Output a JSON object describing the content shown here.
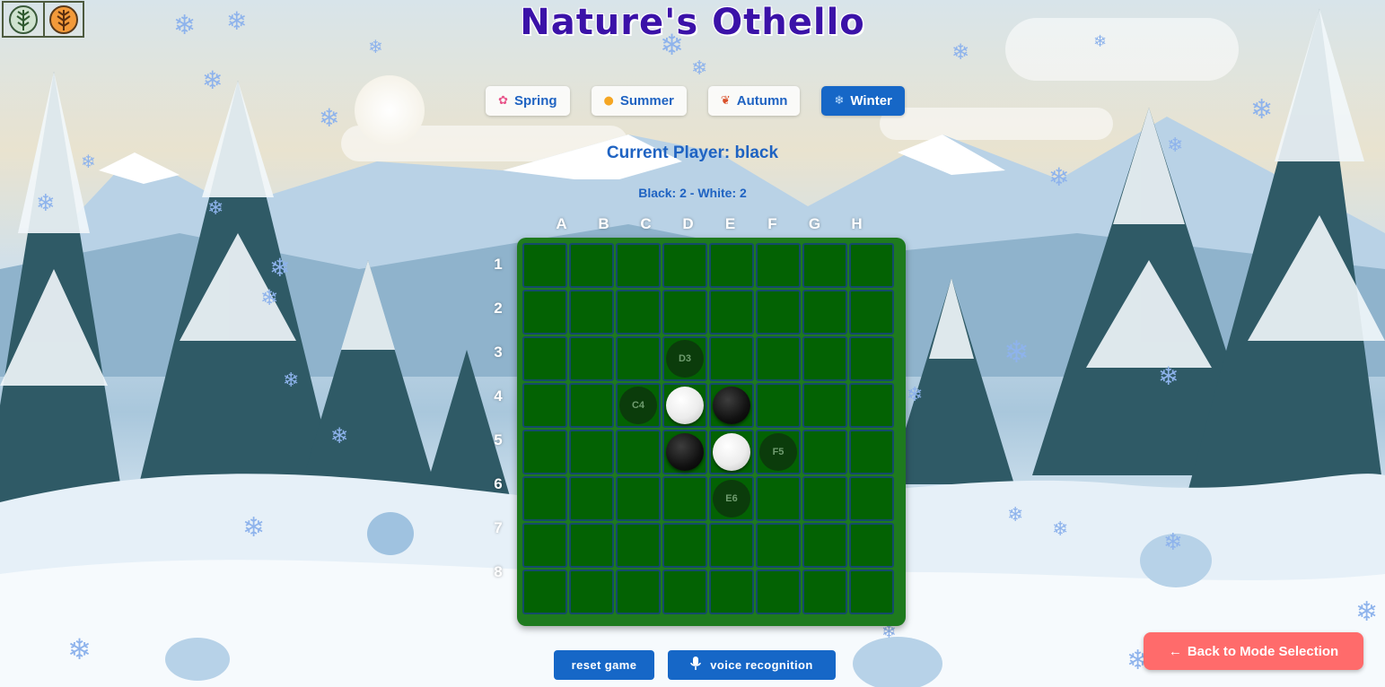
{
  "title": "Nature's Othello",
  "colors": {
    "title": "#3b12a8",
    "accent_blue": "#1667c7",
    "board": "#036203",
    "back_button": "#ff6b6b"
  },
  "seasons": [
    {
      "label": "Spring",
      "icon": "flower-icon",
      "active": false
    },
    {
      "label": "Summer",
      "icon": "sun-icon",
      "active": false
    },
    {
      "label": "Autumn",
      "icon": "leaf-icon",
      "active": false
    },
    {
      "label": "Winter",
      "icon": "snowflake-icon",
      "active": true
    }
  ],
  "status": {
    "current_player": "Current Player: black",
    "score": "Black: 2 - White: 2"
  },
  "board": {
    "columns": [
      "A",
      "B",
      "C",
      "D",
      "E",
      "F",
      "G",
      "H"
    ],
    "rows": [
      "1",
      "2",
      "3",
      "4",
      "5",
      "6",
      "7",
      "8"
    ],
    "pieces": [
      {
        "cell": "D4",
        "color": "white"
      },
      {
        "cell": "E4",
        "color": "black"
      },
      {
        "cell": "D5",
        "color": "black"
      },
      {
        "cell": "E5",
        "color": "white"
      }
    ],
    "valid_moves": [
      "D3",
      "C4",
      "F5",
      "E6"
    ]
  },
  "controls": {
    "reset_label": "reset game",
    "voice_label": "voice recognition",
    "back_label": "Back to Mode Selection"
  }
}
